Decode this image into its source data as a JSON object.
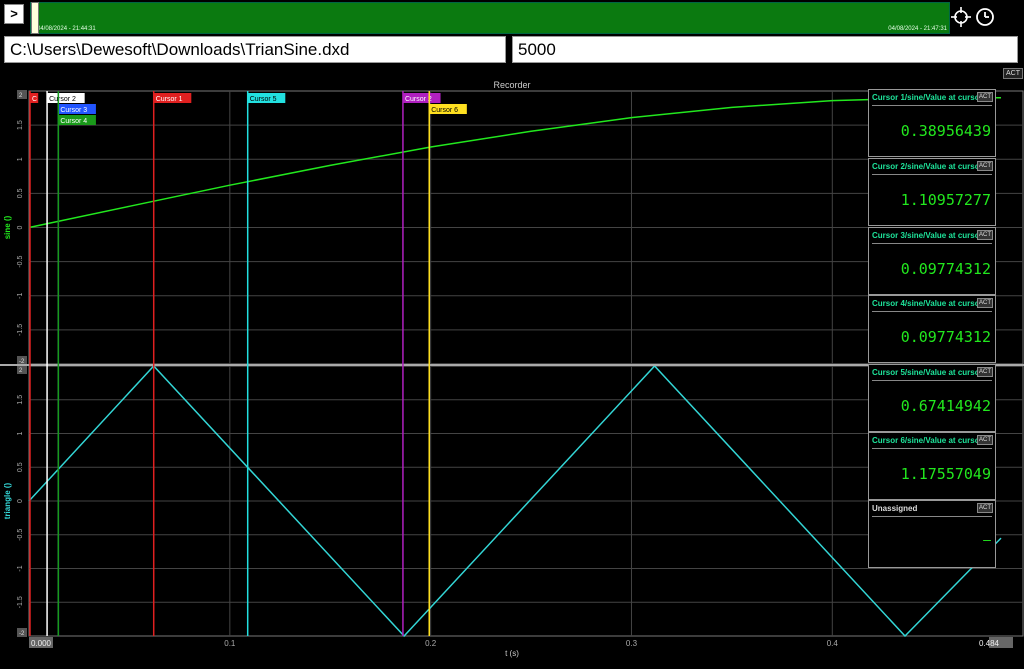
{
  "header": {
    "nav_button": ">",
    "overview_start": "04/08/2024 - 21:44:31",
    "overview_end": "04/08/2024 - 21:47:31",
    "file_path": "C:\\Users\\Dewesoft\\Downloads\\TrianSine.dxd",
    "value": "5000",
    "act_label": "ACT"
  },
  "recorder": {
    "title": "Recorder",
    "xlabel": "t (s)",
    "x_min_label": "0.000",
    "x_max_label": "0.484"
  },
  "colors": {
    "sine": "#22e81e",
    "triangle": "#33d6d6",
    "grid": "#444444",
    "panel_title": "#1ee39a",
    "overview": "#0b7a10"
  },
  "cursors": [
    {
      "label": "C",
      "t": 0.0,
      "color": "#e02020"
    },
    {
      "label": "Cursor 2",
      "t": 0.009,
      "color": "#ffffff"
    },
    {
      "label": "Cursor 3",
      "t": 0.0146,
      "color": "#2255ff"
    },
    {
      "label": "Cursor 4",
      "t": 0.0146,
      "color": "#1a9a1a"
    },
    {
      "label": "Cursor 1",
      "t": 0.0621,
      "color": "#e02020"
    },
    {
      "label": "Cursor 5",
      "t": 0.1089,
      "color": "#22e0e0"
    },
    {
      "label": "Cursor 2",
      "t": 0.1862,
      "color": "#b020c0"
    },
    {
      "label": "Cursor 6",
      "t": 0.1993,
      "color": "#ffe020"
    }
  ],
  "chart_data": [
    {
      "type": "line",
      "title": "Recorder",
      "ylabel": "sine ()",
      "xlabel": "",
      "xlim": [
        0,
        0.484
      ],
      "ylim": [
        -2,
        2
      ],
      "x": [
        0,
        0.05,
        0.1,
        0.15,
        0.2,
        0.25,
        0.3,
        0.35,
        0.4,
        0.45,
        0.484
      ],
      "series": [
        {
          "name": "sine",
          "values": [
            0.0,
            0.31,
            0.62,
            0.91,
            1.18,
            1.41,
            1.61,
            1.76,
            1.86,
            1.9,
            1.9
          ]
        }
      ],
      "yticks": [
        "-2",
        "-1.5",
        "-1",
        "-0.5",
        "0",
        "0.5",
        "1",
        "1.5",
        "2"
      ],
      "xticks": [
        "0.000",
        "0.1",
        "0.2",
        "0.3",
        "0.4",
        "0.484"
      ],
      "grid": true
    },
    {
      "type": "line",
      "ylabel": "triangle ()",
      "xlabel": "t (s)",
      "xlim": [
        0,
        0.484
      ],
      "ylim": [
        -2,
        2
      ],
      "x": [
        0,
        0.0621,
        0.1868,
        0.3115,
        0.4362,
        0.484
      ],
      "series": [
        {
          "name": "triangle",
          "values": [
            0,
            2,
            -2,
            2,
            -2,
            -0.55
          ]
        }
      ],
      "yticks": [
        "-2",
        "-1.5",
        "-1",
        "-0.5",
        "0",
        "0.5",
        "1",
        "1.5",
        "2"
      ],
      "xticks": [
        "0.000",
        "0.1",
        "0.2",
        "0.3",
        "0.4",
        "0.484"
      ],
      "grid": true
    }
  ],
  "panels": [
    {
      "title": "Cursor 1/sine/Value at cursor",
      "value": "0.38956439",
      "act": "ACT"
    },
    {
      "title": "Cursor 2/sine/Value at cursor",
      "value": "1.10957277",
      "act": "ACT"
    },
    {
      "title": "Cursor 3/sine/Value at cursor",
      "value": "0.09774312",
      "act": "ACT"
    },
    {
      "title": "Cursor 4/sine/Value at cursor",
      "value": "0.09774312",
      "act": "ACT"
    },
    {
      "title": "Cursor 5/sine/Value at cursor",
      "value": "0.67414942",
      "act": "ACT"
    },
    {
      "title": "Cursor 6/sine/Value at cursor",
      "value": "1.17557049",
      "act": "ACT"
    },
    {
      "title": "Unassigned",
      "value": "–",
      "act": "ACT"
    }
  ]
}
